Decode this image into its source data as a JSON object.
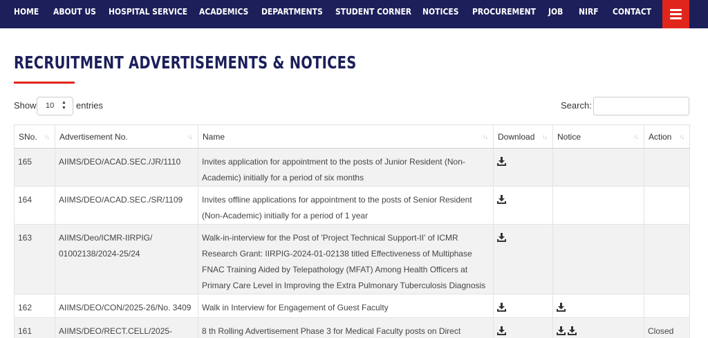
{
  "nav": {
    "items": [
      {
        "label": "HOME",
        "id": "home"
      },
      {
        "label": "ABOUT US",
        "id": "about-us"
      },
      {
        "label": "HOSPITAL SERVICE",
        "id": "hospital-service"
      },
      {
        "label": "ACADEMICS",
        "id": "academics"
      },
      {
        "label": "DEPARTMENTS",
        "id": "departments"
      },
      {
        "label": "STUDENT CORNER",
        "id": "student-corner"
      },
      {
        "label": "NOTICES",
        "id": "notices"
      },
      {
        "label": "PROCUREMENT",
        "id": "procurement"
      },
      {
        "label": "JOB",
        "id": "job"
      },
      {
        "label": "NIRF",
        "id": "nirf"
      },
      {
        "label": "CONTACT",
        "id": "contact"
      }
    ],
    "menu_icon": "hamburger-menu-icon"
  },
  "page": {
    "title": "RECRUITMENT ADVERTISEMENTS & NOTICES"
  },
  "controls": {
    "show_label": "Show",
    "entries_value": "10",
    "entries_label": "entries",
    "search_label": "Search:",
    "search_value": ""
  },
  "table": {
    "headers": [
      "SNo.",
      "Advertisement No.",
      "Name",
      "Download",
      "Notice",
      "Action"
    ],
    "rows": [
      {
        "sno": "165",
        "adv_no": "AIIMS/DEO/ACAD.SEC./JR/1110",
        "name": "Invites application for appointment to the posts of Junior Resident (Non-Academic) initially for a period of six months",
        "download_icons": 1,
        "notice_icons": 0,
        "action": ""
      },
      {
        "sno": "164",
        "adv_no": "AIIMS/DEO/ACAD.SEC./SR/1109",
        "name": "Invites offline applications for appointment to the posts of Senior Resident (Non-Academic) initially for a period of 1 year",
        "download_icons": 1,
        "notice_icons": 0,
        "action": ""
      },
      {
        "sno": "163",
        "adv_no": "AIIMS/Deo/ICMR-IIRPIG/ 01002138/2024-25/24",
        "name": "Walk-in-interview for the Post of 'Project Technical Support-II' of ICMR Research Grant: IIRPIG-2024-01-02138 titled Effectiveness of Multiphase FNAC Training Aided by Telepathology (MFAT) Among Health Officers at Primary Care Level in Improving the Extra Pulmonary Tuberculosis Diagnosis",
        "download_icons": 1,
        "notice_icons": 0,
        "action": ""
      },
      {
        "sno": "162",
        "adv_no": "AIIMS/DEO/CON/2025-26/No. 3409",
        "name": "Walk in Interview for Engagement of Guest Faculty",
        "download_icons": 1,
        "notice_icons": 1,
        "action": ""
      },
      {
        "sno": "161",
        "adv_no": "AIIMS/DEO/RECT.CELL/2025-",
        "name": "8 th Rolling Advertisement Phase 3 for Medical Faculty posts on Direct",
        "download_icons": 1,
        "notice_icons": 2,
        "action": "Closed"
      }
    ]
  },
  "colors": {
    "nav_bg": "#1c1f5a",
    "accent": "#e0261c",
    "title": "#1c1f5a"
  }
}
